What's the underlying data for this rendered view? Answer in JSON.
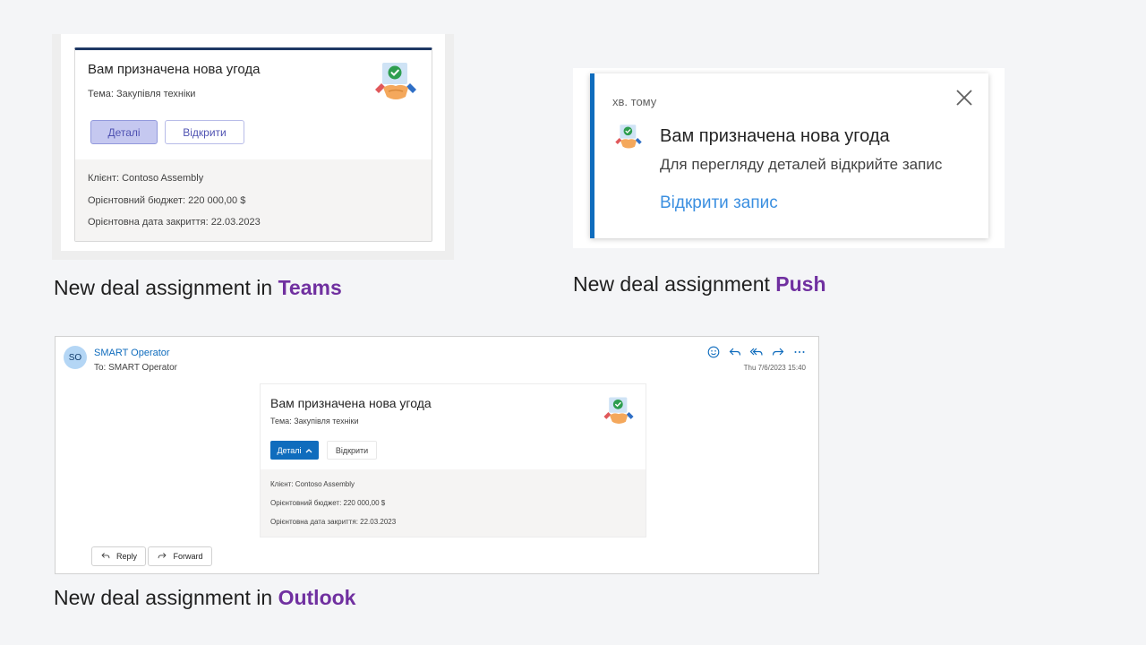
{
  "teams": {
    "card": {
      "title": "Вам призначена нова угода",
      "subject": "Тема: Закупівля техніки",
      "details_button": "Деталі",
      "open_button": "Відкрити",
      "facts": [
        "Клієнт: Contoso Assembly",
        "Орієнтовний бюджет: 220 000,00 $",
        "Орієнтовна дата закриття: 22.03.2023"
      ]
    },
    "caption_prefix": "New deal assignment in ",
    "caption_highlight": "Teams"
  },
  "push": {
    "time_ago": "хв. тому",
    "title": "Вам призначена нова угода",
    "body": "Для перегляду деталей відкрийте запис",
    "link": "Відкрити запис",
    "caption_prefix": "New deal assignment ",
    "caption_highlight": "Push"
  },
  "outlook": {
    "avatar_initials": "SO",
    "sender": "SMART Operator",
    "to_line": "To:  SMART Operator",
    "date": "Thu 7/6/2023 15:40",
    "toolbar_icons": [
      "smiley-icon",
      "reply-icon",
      "reply-all-icon",
      "forward-icon",
      "more-icon"
    ],
    "card": {
      "title": "Вам призначена нова угода",
      "subject": "Тема: Закупівля техніки",
      "details_button": "Деталі",
      "open_button": "Відкрити",
      "facts": [
        "Клієнт: Contoso Assembly",
        "Орієнтовний бюджет: 220 000,00 $",
        "Орієнтовна дата закриття: 22.03.2023"
      ]
    },
    "reply_label": "Reply",
    "forward_label": "Forward",
    "caption_prefix": "New deal assignment in ",
    "caption_highlight": "Outlook"
  },
  "colors": {
    "highlight": "#7030a0",
    "teams_border": "#1f3864",
    "push_accent": "#0f6cbd",
    "outlook_primary": "#0f6cbd"
  }
}
